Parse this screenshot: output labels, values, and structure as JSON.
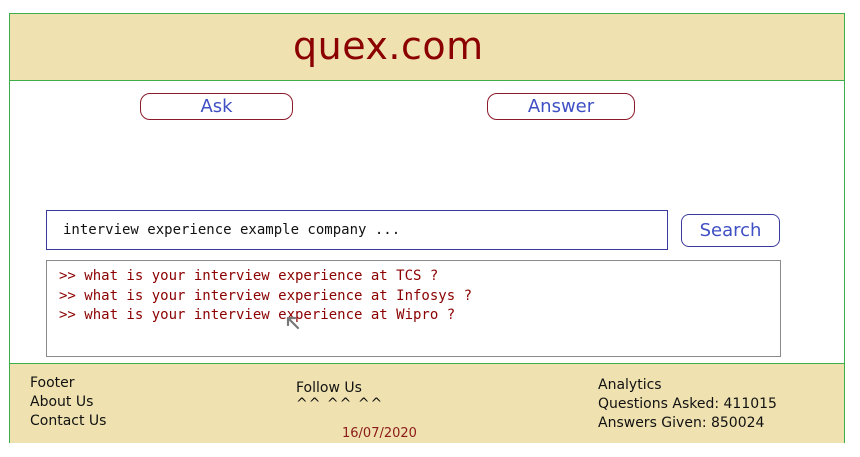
{
  "header": {
    "site_title": "quex.com"
  },
  "nav": {
    "ask_label": "Ask",
    "answer_label": "Answer"
  },
  "search": {
    "value": "interview experience example company ...",
    "button_label": "Search",
    "suggestions": [
      ">> what is your interview experience at TCS ?",
      ">> what is your interview experience at Infosys ?",
      ">> what is your interview experience at Wipro ?"
    ]
  },
  "footer": {
    "footer_label": "Footer",
    "about_label": "About Us",
    "contact_label": "Contact Us",
    "follow_label": "Follow Us",
    "social_icons": "^^  ^^  ^^",
    "date": "16/07/2020",
    "analytics_label": "Analytics",
    "questions_asked": "Questions Asked: 411015",
    "answers_given": "Answers Given: 850024"
  },
  "colors": {
    "header_bg": "#efe2b0",
    "border_green": "#3fae49",
    "title_red": "#8b0000",
    "link_blue": "#3f4fc4"
  }
}
